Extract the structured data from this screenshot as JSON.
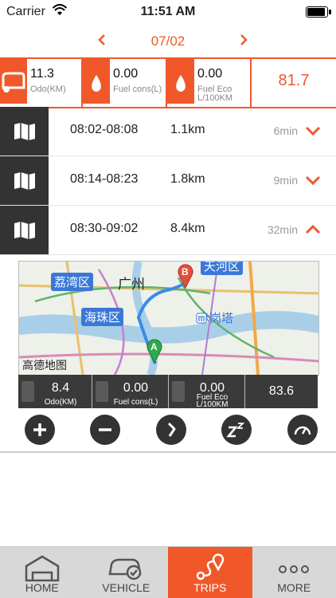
{
  "status_bar": {
    "carrier": "Carrier",
    "time": "11:51 AM"
  },
  "date_nav": {
    "date": "07/02"
  },
  "summary": {
    "odo": {
      "value": "11.3",
      "label": "Odo(KM)"
    },
    "fuel_cons": {
      "value": "0.00",
      "label": "Fuel cons(L)"
    },
    "fuel_eco": {
      "value": "0.00",
      "label_line1": "Fuel Eco",
      "label_line2": "L/100KM"
    },
    "score": "81.7"
  },
  "trips": [
    {
      "range": "08:02-08:08",
      "distance": "1.1km",
      "duration": "6min",
      "expanded": false
    },
    {
      "range": "08:14-08:23",
      "distance": "1.8km",
      "duration": "9min",
      "expanded": false
    },
    {
      "range": "08:30-09:02",
      "distance": "8.4km",
      "duration": "32min",
      "expanded": true
    }
  ],
  "map": {
    "labels": [
      "荔湾区",
      "广州",
      "海珠区",
      "赤岗塔",
      "天河区"
    ],
    "attribution": "高德地图",
    "marker_start": "A",
    "marker_end": "B"
  },
  "trip_detail": {
    "odo": {
      "value": "8.4",
      "label": "Odo(KM)"
    },
    "fuel_cons": {
      "value": "0.00",
      "label": "Fuel cons(L)"
    },
    "fuel_eco": {
      "value": "0.00",
      "label_line1": "Fuel Eco",
      "label_line2": "L/100KM"
    },
    "score": "83.6"
  },
  "tabs": [
    {
      "label": "HOME",
      "icon": "garage-icon",
      "active": false
    },
    {
      "label": "VEHICLE",
      "icon": "car-check-icon",
      "active": false
    },
    {
      "label": "TRIPS",
      "icon": "route-icon",
      "active": true
    },
    {
      "label": "MORE",
      "icon": "more-dots-icon",
      "active": false
    }
  ],
  "colors": {
    "accent": "#f0582a",
    "dark": "#333333"
  }
}
